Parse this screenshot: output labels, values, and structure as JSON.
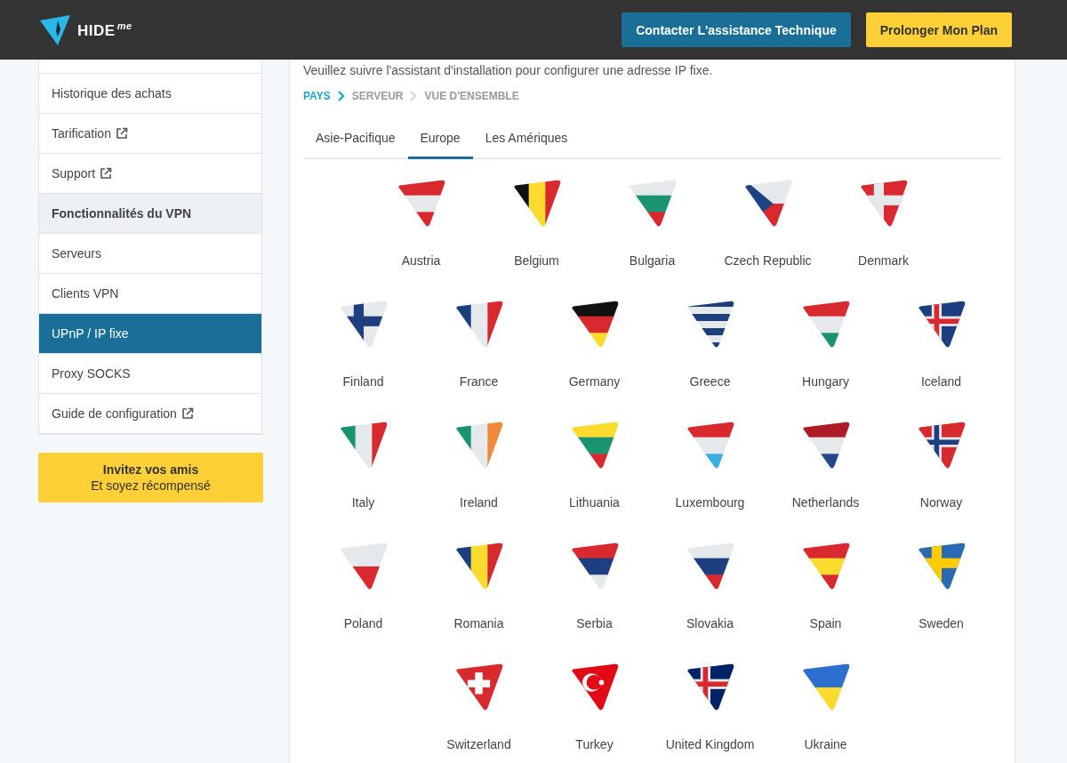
{
  "header": {
    "logo": "HIDE",
    "logo_suffix": "me",
    "buttons": [
      {
        "label": "Contacter L'assistance Technique",
        "kind": "primary"
      },
      {
        "label": "Prolonger Mon Plan",
        "kind": "accent"
      }
    ]
  },
  "sidebar": {
    "items": [
      {
        "label": "Historique des achats",
        "kind": "link",
        "external": false,
        "selected": false
      },
      {
        "label": "Tarification",
        "kind": "link",
        "external": true,
        "selected": false
      },
      {
        "label": "Support",
        "kind": "link",
        "external": true,
        "selected": false
      },
      {
        "label": "Fonctionnalités du VPN",
        "kind": "section"
      },
      {
        "label": "Serveurs",
        "kind": "link",
        "external": false,
        "selected": false
      },
      {
        "label": "Clients VPN",
        "kind": "link",
        "external": false,
        "selected": false
      },
      {
        "label": "UPnP / IP fixe",
        "kind": "link",
        "external": false,
        "selected": true
      },
      {
        "label": "Proxy SOCKS",
        "kind": "link",
        "external": false,
        "selected": false
      },
      {
        "label": "Guide de configuration",
        "kind": "link",
        "external": true,
        "selected": false
      }
    ],
    "invite": {
      "title": "Invitez vos amis",
      "subtitle": "Et soyez récompensé"
    }
  },
  "main": {
    "intro": "Veuillez suivre l'assistant d'installation pour configurer une adresse IP fixe.",
    "steps": [
      {
        "label": "PAYS",
        "selected": true
      },
      {
        "label": "SERVEUR",
        "selected": false
      },
      {
        "label": "VUE D'ENSEMBLE",
        "selected": false
      }
    ],
    "tabs": [
      {
        "label": "Asie-Pacifique",
        "selected": false
      },
      {
        "label": "Europe",
        "selected": true
      },
      {
        "label": "Les Amériques",
        "selected": false
      }
    ],
    "country_rows": [
      [
        "Austria",
        "Belgium",
        "Bulgaria",
        "Czech Republic",
        "Denmark"
      ],
      [
        "Finland",
        "France",
        "Germany",
        "Greece",
        "Hungary",
        "Iceland"
      ],
      [
        "Italy",
        "Ireland",
        "Lithuania",
        "Luxembourg",
        "Netherlands",
        "Norway"
      ],
      [
        "Poland",
        "Romania",
        "Serbia",
        "Slovakia",
        "Spain",
        "Sweden"
      ],
      [
        "Switzerland",
        "Turkey",
        "United Kingdom",
        "Ukraine"
      ]
    ]
  }
}
